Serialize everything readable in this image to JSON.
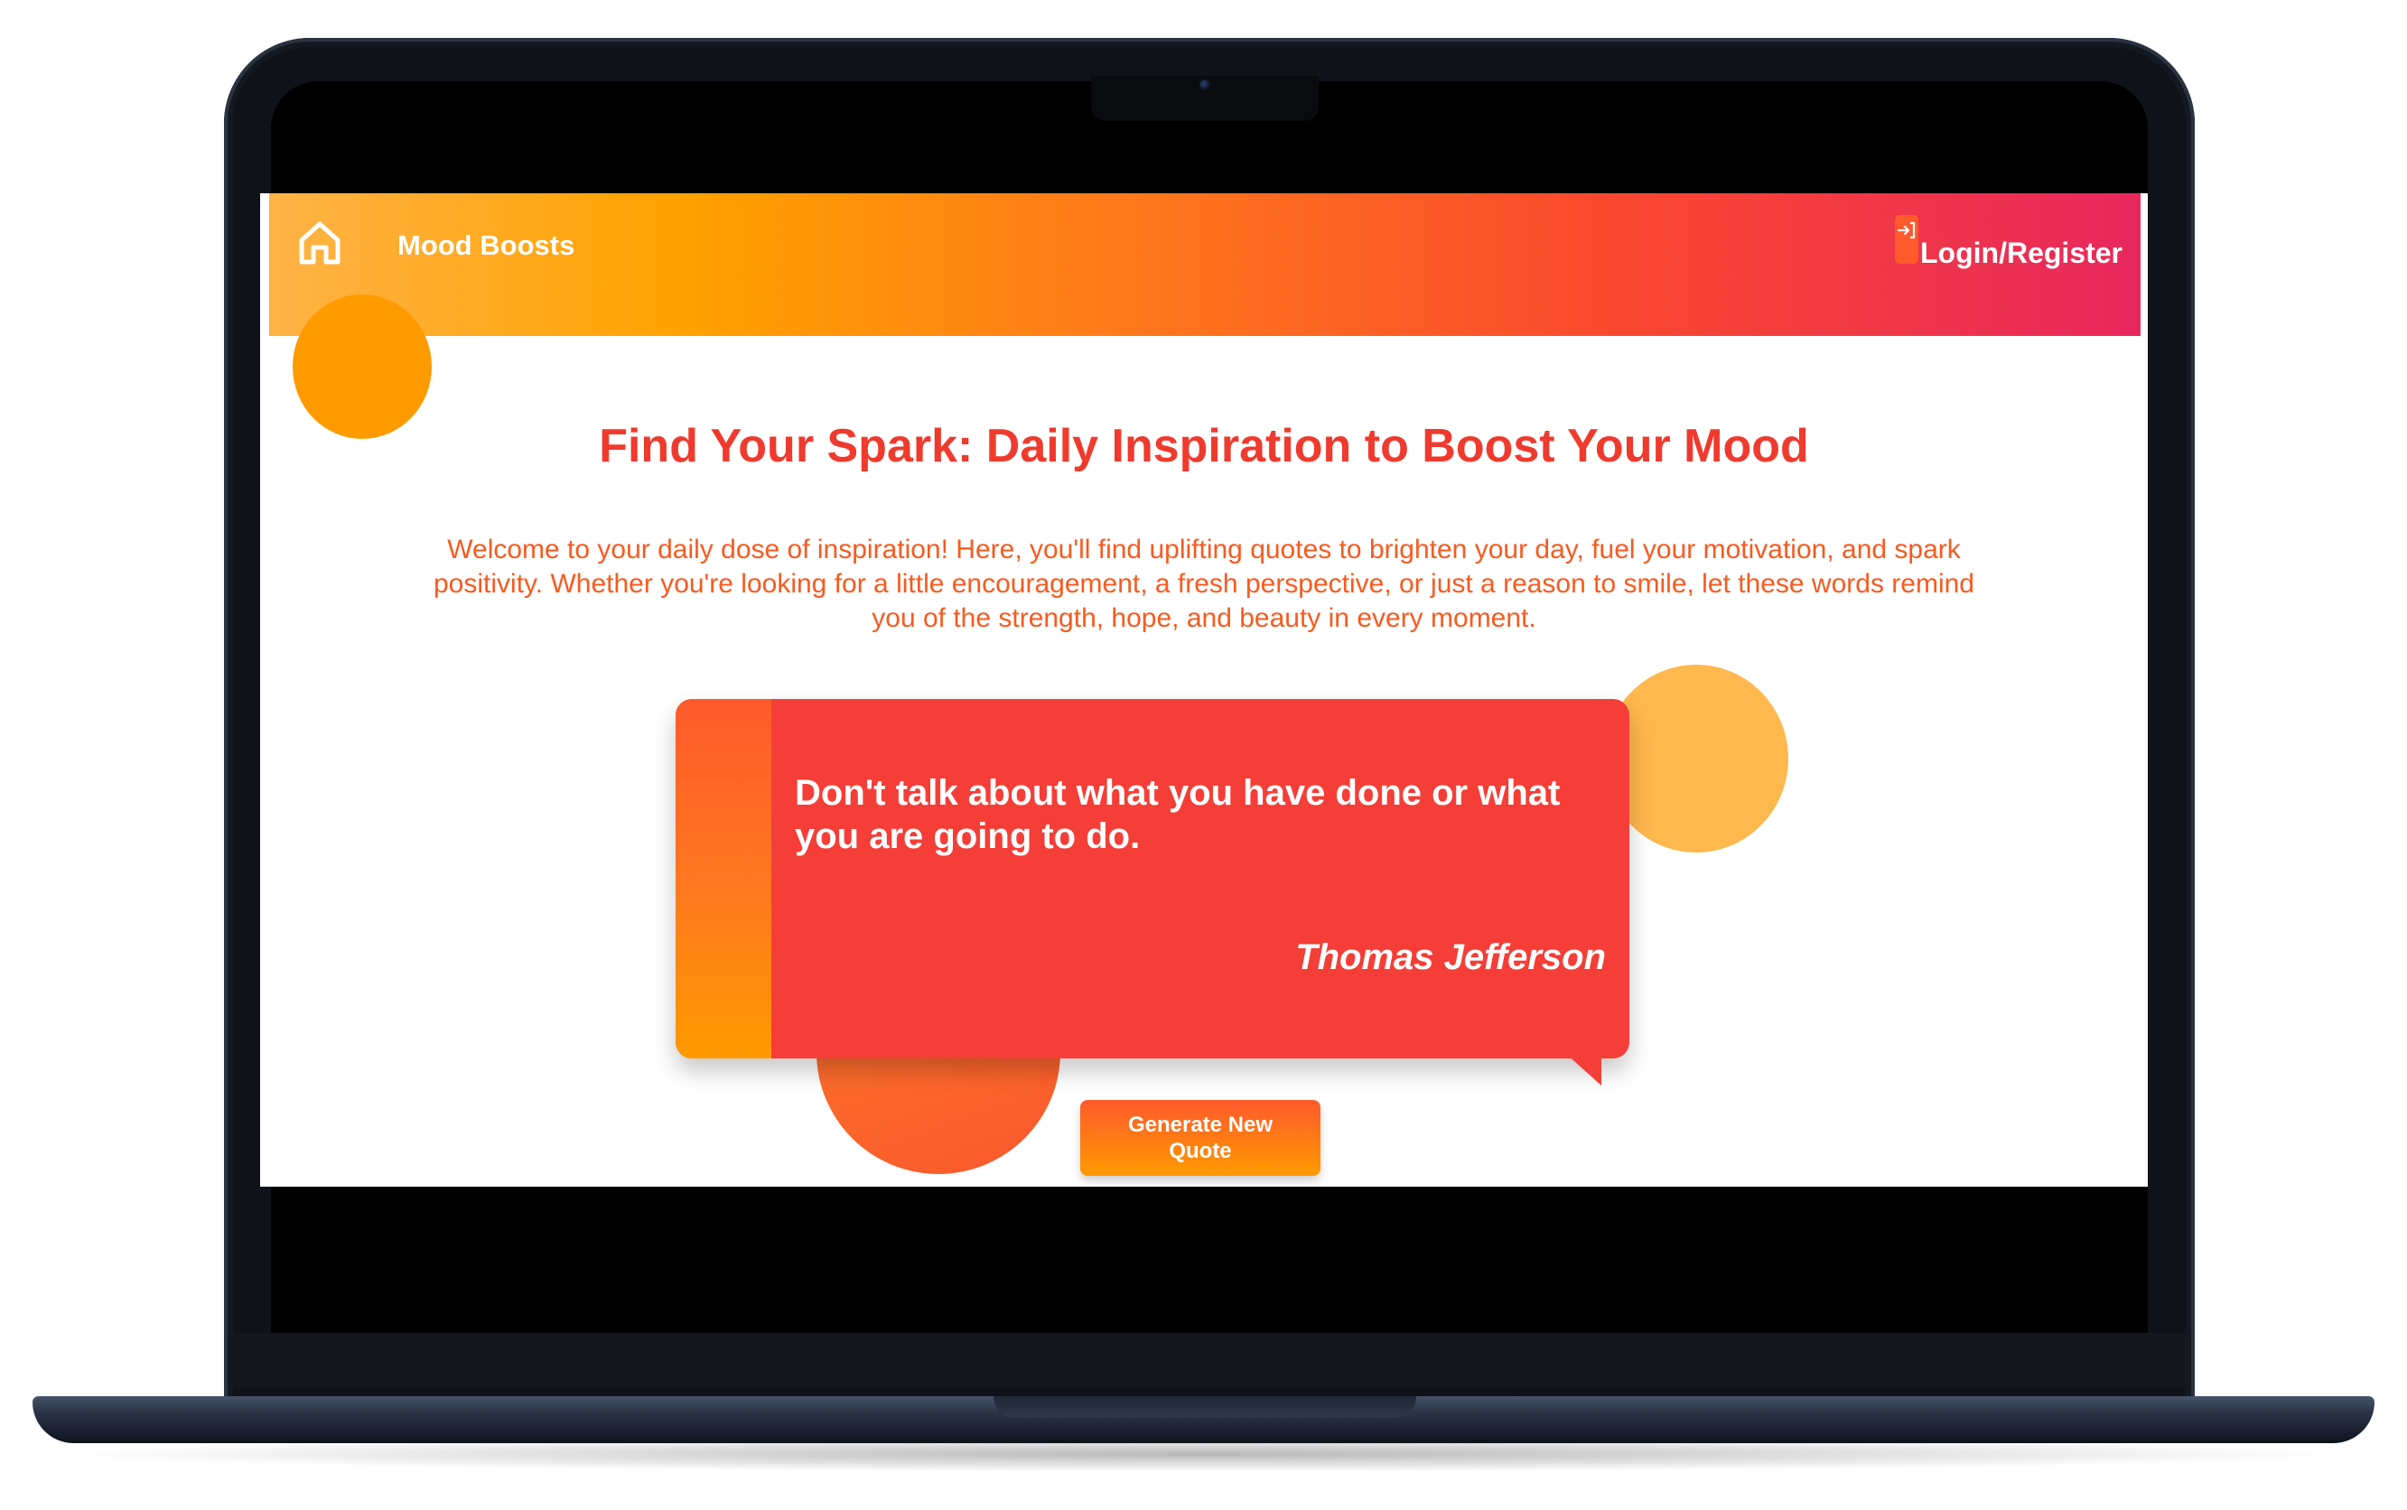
{
  "nav": {
    "home_icon": "home-icon",
    "brand": "Mood Boosts",
    "login_icon": "login-icon",
    "login_label": "Login/Register"
  },
  "hero": {
    "title": "Find Your Spark: Daily Inspiration to Boost Your Mood",
    "intro": "Welcome to your daily dose of inspiration! Here, you'll find uplifting quotes to brighten your day, fuel your motivation, and spark positivity. Whether you're looking for a little encouragement, a fresh perspective, or just a reason to smile, let these words remind you of the strength, hope, and beauty in every moment."
  },
  "quote": {
    "text": "Don't talk about what you have done or what you are going to do.",
    "author": "Thomas Jefferson"
  },
  "actions": {
    "generate_label": "Generate New Quote"
  },
  "colors": {
    "gradient_start": "#ffb347",
    "gradient_mid": "#ff7a1a",
    "gradient_end": "#e8275e",
    "title_red": "#ef3a2e",
    "intro_orange": "#f95a1f",
    "card_red": "#f43e37",
    "accent_orange": "#ff9a00"
  }
}
